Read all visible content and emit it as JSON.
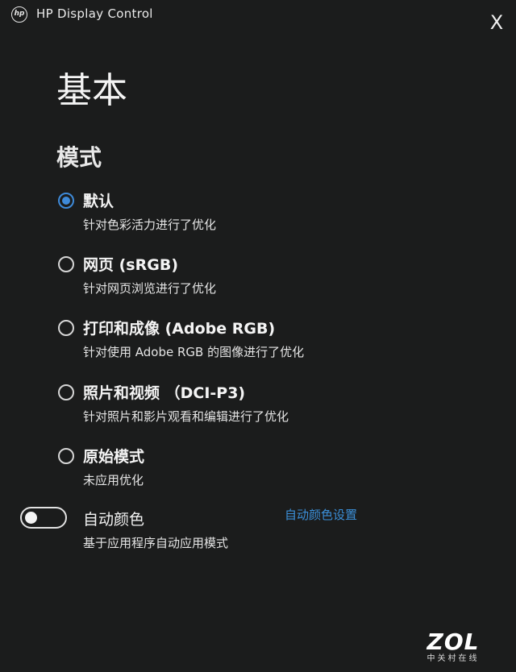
{
  "titlebar": {
    "logo_text": "hp",
    "app_title": "HP Display Control",
    "close_label": "X"
  },
  "page": {
    "title": "基本"
  },
  "mode_section": {
    "title": "模式",
    "selected": 0,
    "options": [
      {
        "label": "默认",
        "description": "针对色彩活力进行了优化"
      },
      {
        "label": "网页 (sRGB)",
        "description": "针对网页浏览进行了优化"
      },
      {
        "label": "打印和成像 (Adobe RGB)",
        "description": "针对使用 Adobe RGB 的图像进行了优化"
      },
      {
        "label": "照片和视频 （DCI-P3)",
        "description": "针对照片和影片观看和编辑进行了优化"
      },
      {
        "label": "原始模式",
        "description": "未应用优化"
      }
    ]
  },
  "auto_color": {
    "label": "自动颜色",
    "description": "基于应用程序自动应用模式",
    "enabled": false,
    "settings_link": "自动颜色设置"
  },
  "watermark": {
    "main": "ZOL",
    "sub": "中关村在线"
  },
  "colors": {
    "background": "#1b1c1c",
    "accent": "#3e8ad9",
    "link": "#3b8fd8"
  }
}
